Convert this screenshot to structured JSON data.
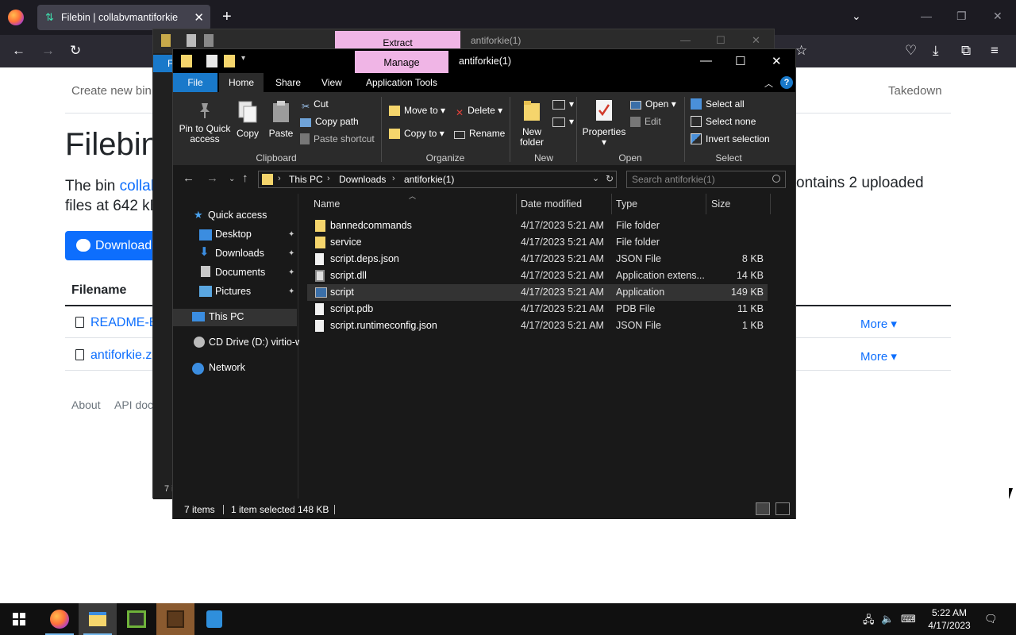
{
  "browser": {
    "tab_title": "Filebin | collabvmantiforkie",
    "tab_favicon": "filebin-arrows-icon",
    "theme": "#1c1b22"
  },
  "filebin_page": {
    "nav_left": "Create new bin",
    "nav_right": "Takedown",
    "heading": "Filebin",
    "desc_prefix": "The bin ",
    "desc_link": "collab",
    "desc_suffix": "ontains 2 uploaded",
    "desc_line2": "files at 642 kB",
    "download_label": "Download",
    "table_header": "Filename",
    "files": [
      {
        "name": "README-E",
        "more": "More"
      },
      {
        "name": "antiforkie.z",
        "more": "More"
      }
    ],
    "footer": {
      "about": "About",
      "api": "API doc"
    }
  },
  "back_explorer": {
    "context_tab": "Extract",
    "title": "antiforkie(1)",
    "file_tab": "F",
    "status": "7 i"
  },
  "explorer": {
    "context_tab": "Manage",
    "title": "antiforkie(1)",
    "tabs": [
      "File",
      "Home",
      "Share",
      "View",
      "Application Tools"
    ],
    "ribbon": {
      "clipboard": {
        "label": "Clipboard",
        "pin_l1": "Pin to Quick",
        "pin_l2": "access",
        "copy": "Copy",
        "paste": "Paste",
        "cut": "Cut",
        "copy_path": "Copy path",
        "paste_shortcut": "Paste shortcut"
      },
      "organize": {
        "label": "Organize",
        "move_to": "Move to",
        "copy_to": "Copy to",
        "delete": "Delete",
        "rename": "Rename"
      },
      "new": {
        "label": "New",
        "new_folder_l1": "New",
        "new_folder_l2": "folder"
      },
      "open": {
        "label": "Open",
        "properties": "Properties",
        "open": "Open",
        "edit": "Edit"
      },
      "select": {
        "label": "Select",
        "select_all": "Select all",
        "select_none": "Select none",
        "invert": "Invert selection"
      }
    },
    "address": {
      "crumbs": [
        "This PC",
        "Downloads",
        "antiforkie(1)"
      ],
      "search_placeholder": "Search antiforkie(1)"
    },
    "nav_pane": {
      "quick_access": "Quick access",
      "items": [
        "Desktop",
        "Downloads",
        "Documents",
        "Pictures"
      ],
      "this_pc": "This PC",
      "cd_drive": "CD Drive (D:) virtio-w",
      "network": "Network"
    },
    "columns": {
      "name": "Name",
      "date": "Date modified",
      "type": "Type",
      "size": "Size"
    },
    "files": [
      {
        "name": "bannedcommands",
        "date": "4/17/2023 5:21 AM",
        "type": "File folder",
        "size": "",
        "icon": "folder-icon"
      },
      {
        "name": "service",
        "date": "4/17/2023 5:21 AM",
        "type": "File folder",
        "size": "",
        "icon": "folder-icon"
      },
      {
        "name": "script.deps.json",
        "date": "4/17/2023 5:21 AM",
        "type": "JSON File",
        "size": "8 KB",
        "icon": "file-icon"
      },
      {
        "name": "script.dll",
        "date": "4/17/2023 5:21 AM",
        "type": "Application extens...",
        "size": "14 KB",
        "icon": "dll-icon"
      },
      {
        "name": "script",
        "date": "4/17/2023 5:21 AM",
        "type": "Application",
        "size": "149 KB",
        "icon": "app-icon",
        "selected": true
      },
      {
        "name": "script.pdb",
        "date": "4/17/2023 5:21 AM",
        "type": "PDB File",
        "size": "11 KB",
        "icon": "file-icon"
      },
      {
        "name": "script.runtimeconfig.json",
        "date": "4/17/2023 5:21 AM",
        "type": "JSON File",
        "size": "1 KB",
        "icon": "file-icon"
      }
    ],
    "status": {
      "items": "7 items",
      "selected": "1 item selected  148 KB"
    },
    "accent": "#1979ca",
    "context_color": "#f0b5e6"
  },
  "taskbar": {
    "apps": [
      "firefox-icon",
      "file-explorer-icon",
      "nvidia-app-icon",
      "minecraft-icon",
      "app-icon-blue"
    ],
    "clock_time": "5:22 AM",
    "clock_date": "4/17/2023"
  }
}
